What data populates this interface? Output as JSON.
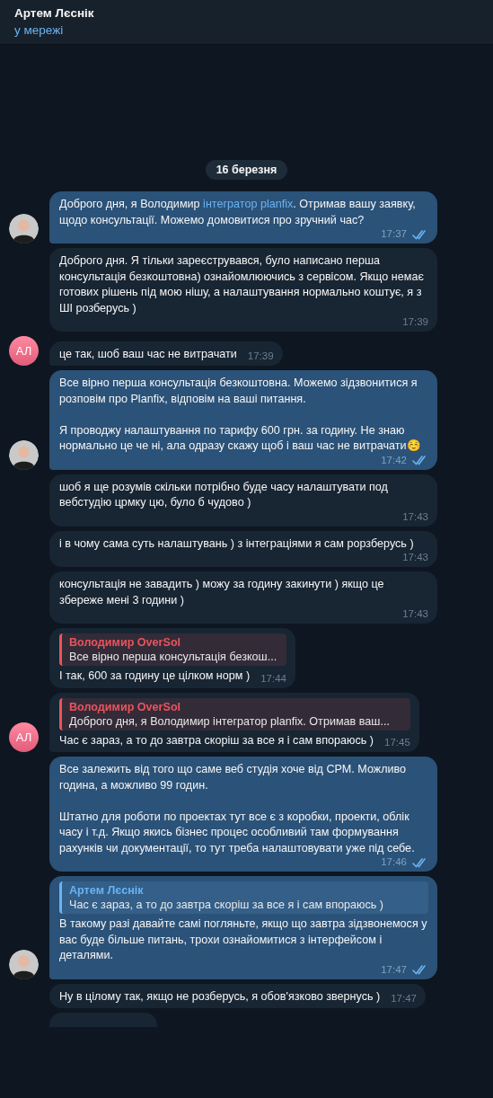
{
  "header": {
    "title": "Артем Лєснік",
    "status": "у мережі"
  },
  "date_badge": "16 березня",
  "messages": [
    {
      "kind": "out",
      "parts": [
        {
          "kind": "plain",
          "text": "Доброго дня, я Володимир "
        },
        {
          "kind": "link",
          "text": "інтегратор planfix"
        },
        {
          "kind": "plain",
          "text": ". Отримав вашу заявку, щодо консультації. Можемо домовитися про зручний час?"
        }
      ],
      "time": "17:37",
      "read": true,
      "avatar": {
        "kind": "photo"
      }
    },
    {
      "kind": "in",
      "parts": [
        {
          "kind": "plain",
          "text": "Доброго дня. Я тільки зареєструвався, було написано перша консультація безкоштовна) ознайомлюючись з сервісом. Якщо немає готових рішень під мою нішу, а налаштування нормально коштує, я з ШІ розберусь )"
        }
      ],
      "time": "17:39"
    },
    {
      "kind": "in",
      "parts": [
        {
          "kind": "plain",
          "text": "це так, шоб ваш час не витрачати"
        }
      ],
      "time": "17:39",
      "avatar": {
        "kind": "initials",
        "text": "АЛ"
      }
    },
    {
      "kind": "out",
      "parts": [
        {
          "kind": "plain",
          "text": "Все вірно перша консультація безкоштовна. Можемо зідзвонитися я розповім про Planfix, відповім на ваші питання.\n\nЯ проводжу налаштування по тарифу 600 грн. за годину. Не знаю нормально це че ні, ала одразу скажу щоб і ваш час не витрачати☺️"
        }
      ],
      "time": "17:42",
      "read": true,
      "avatar": {
        "kind": "photo"
      }
    },
    {
      "kind": "in",
      "parts": [
        {
          "kind": "plain",
          "text": "шоб я ще розумів скільки потрібно буде часу налаштувати под вебстудію црмку цю, було б чудово )"
        }
      ],
      "time": "17:43"
    },
    {
      "kind": "in",
      "parts": [
        {
          "kind": "plain",
          "text": "і в чому сама суть налаштувань ) з інтеграціями я сам рорзберусь )"
        }
      ],
      "time": "17:43"
    },
    {
      "kind": "in",
      "parts": [
        {
          "kind": "plain",
          "text": "консультація не завадить ) можу за годину закинути ) якщо це збереже мені 3 години )"
        }
      ],
      "time": "17:43"
    },
    {
      "kind": "in",
      "reply": {
        "author": "Володимир OverSol",
        "text": "Все вірно перша консультація безкош...",
        "color": "#e8545d"
      },
      "parts": [
        {
          "kind": "plain",
          "text": "І так, 600 за годину це цілком норм )"
        }
      ],
      "time": "17:44"
    },
    {
      "kind": "in",
      "reply": {
        "author": "Володимир OverSol",
        "text": "Доброго дня, я Володимир інтегратор planfix. Отримав ваш...",
        "color": "#e8545d"
      },
      "parts": [
        {
          "kind": "plain",
          "text": "Час є зараз, а то до завтра скоріш за все я і сам впораюсь )"
        }
      ],
      "time": "17:45",
      "avatar": {
        "kind": "initials",
        "text": "АЛ"
      }
    },
    {
      "kind": "out",
      "parts": [
        {
          "kind": "plain",
          "text": "Все залежить від того що саме веб студія хоче від СРМ. Можливо година, а можливо 99 годин.\n\nШтатно для роботи по проектах тут все є з коробки, проекти, облік часу і т.д. Якщо якись бізнес процес особливий там формування рахунків чи документації, то тут треба налаштовувати уже під себе."
        }
      ],
      "time": "17:46",
      "read": true
    },
    {
      "kind": "out",
      "reply": {
        "author": "Артем Лєснік",
        "text": "Час є зараз, а то до завтра скоріш за все я і сам впораюсь )",
        "color": "#6ab3f3"
      },
      "parts": [
        {
          "kind": "plain",
          "text": "В такому разі давайте самі погляньте, якщо що завтра зідзвонемося у вас буде більше питань, трохи ознайомитися з інтерфейсом і деталями."
        }
      ],
      "time": "17:47",
      "read": true,
      "avatar": {
        "kind": "photo"
      }
    },
    {
      "kind": "in",
      "parts": [
        {
          "kind": "plain",
          "text": "Ну в цілому так, якщо не розберусь, я обов'язково звернусь )"
        }
      ],
      "time": "17:47"
    },
    {
      "kind": "partial"
    }
  ]
}
